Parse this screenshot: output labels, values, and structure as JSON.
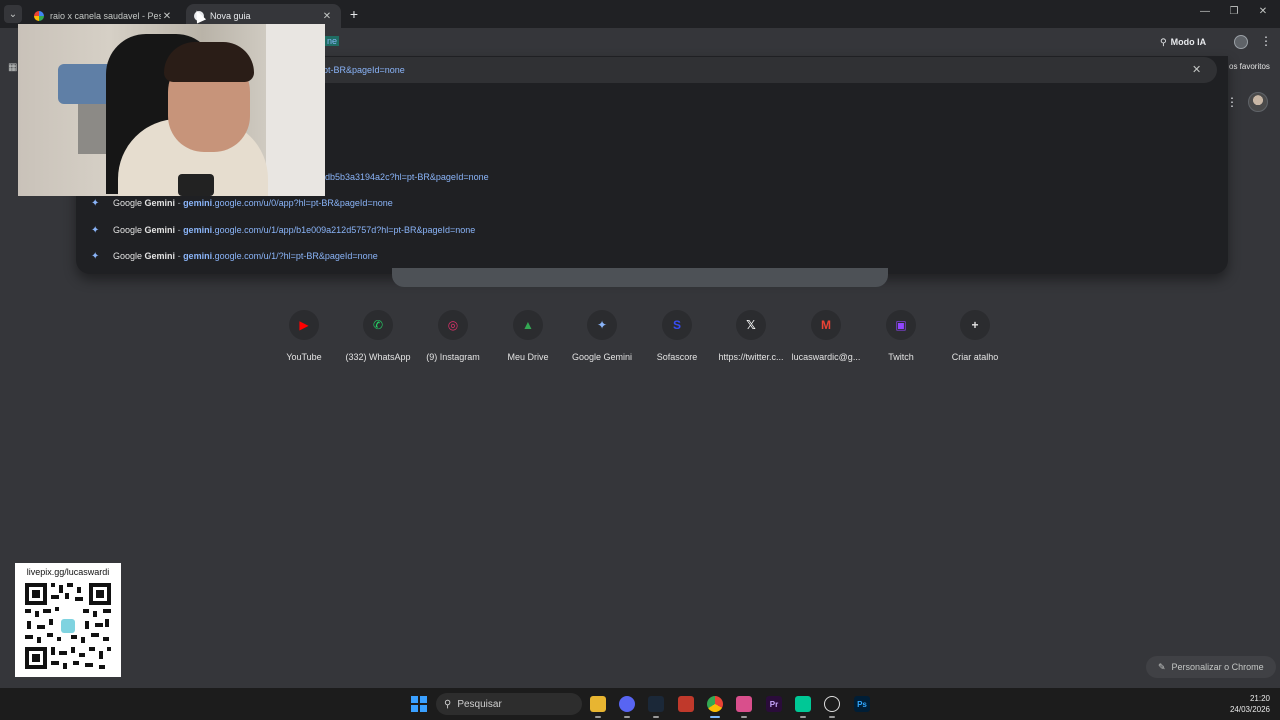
{
  "tabs": [
    {
      "title": "raio x canela saudavel - Pesquisa",
      "active": false
    },
    {
      "title": "Nova guia",
      "active": true
    }
  ],
  "toolbar": {
    "omnibox_tail": "ne",
    "ai_mode_label": "Modo IA",
    "bookmarks_label": "os favoritos"
  },
  "dropdown": {
    "top_url": "pt-BR&pageId=none",
    "partial_url": "db5b3a3194a2c?hl=pt-BR&pageId=none",
    "suggestions": [
      {
        "site": "Google",
        "bold": "Gemini",
        "sep": " - ",
        "domain": "gemini",
        "path": ".google.com/u/0/app?hl=pt-BR&pageId=none"
      },
      {
        "site": "Google",
        "bold": "Gemini",
        "sep": " - ",
        "domain": "gemini",
        "path": ".google.com/u/1/app/b1e009a212d5757d?hl=pt-BR&pageId=none"
      },
      {
        "site": "Google",
        "bold": "Gemini",
        "sep": " - ",
        "domain": "gemini",
        "path": ".google.com/u/1/?hl=pt-BR&pageId=none"
      }
    ]
  },
  "shortcuts": [
    {
      "label": "YouTube",
      "icon": "youtube-icon",
      "color": "#ff0000",
      "glyph": "▶"
    },
    {
      "label": "(332) WhatsApp",
      "icon": "whatsapp-icon",
      "color": "#25d366",
      "glyph": "✆"
    },
    {
      "label": "(9) Instagram",
      "icon": "instagram-icon",
      "color": "#e1306c",
      "glyph": "◎"
    },
    {
      "label": "Meu Drive",
      "icon": "drive-icon",
      "color": "#34a853",
      "glyph": "▲"
    },
    {
      "label": "Google Gemini",
      "icon": "gemini-icon",
      "color": "#8ab4f8",
      "glyph": "✦"
    },
    {
      "label": "Sofascore",
      "icon": "sofascore-icon",
      "color": "#374df5",
      "glyph": "S"
    },
    {
      "label": "https://twitter.c...",
      "icon": "x-icon",
      "color": "#ffffff",
      "glyph": "𝕏"
    },
    {
      "label": "lucaswardic@g...",
      "icon": "gmail-icon",
      "color": "#ea4335",
      "glyph": "M"
    },
    {
      "label": "Twitch",
      "icon": "twitch-icon",
      "color": "#9146ff",
      "glyph": "▣"
    },
    {
      "label": "Criar atalho",
      "icon": "plus-icon",
      "color": "#e3e3e3",
      "glyph": "+"
    }
  ],
  "customize_label": "Personalizar o Chrome",
  "qr_card": {
    "title": "livepix.gg/lucaswardi"
  },
  "taskbar": {
    "search_placeholder": "Pesquisar",
    "time": "21:20",
    "date": "24/03/2026"
  }
}
